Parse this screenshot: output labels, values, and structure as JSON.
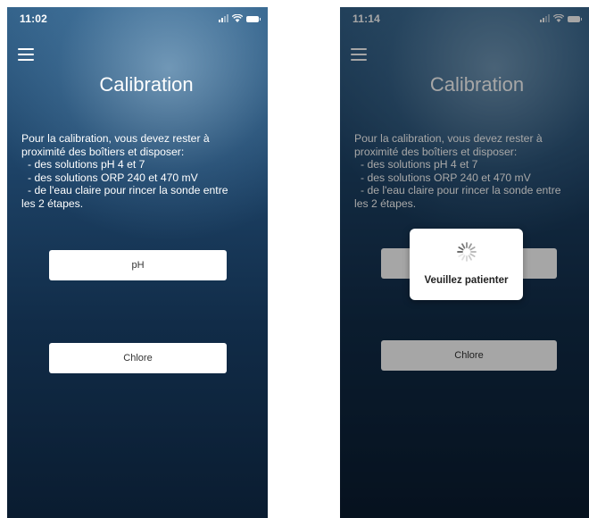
{
  "screens": [
    {
      "status": {
        "time": "11:02"
      },
      "title": "Calibration",
      "instructions": {
        "intro_line1": "Pour la calibration, vous devez rester à",
        "intro_line2": "proximité des boîtiers et disposer:",
        "bullet1": "- des solutions pH 4 et 7",
        "bullet2": "- des solutions ORP 240 et 470 mV",
        "bullet3_line1": "- de l'eau claire pour rincer la sonde entre",
        "bullet3_line2": "les 2 étapes."
      },
      "buttons": {
        "ph": "pH",
        "chlore": "Chlore"
      }
    },
    {
      "status": {
        "time": "11:14"
      },
      "title": "Calibration",
      "instructions": {
        "intro_line1": "Pour la calibration, vous devez rester à",
        "intro_line2": "proximité des boîtiers et disposer:",
        "bullet1": "- des solutions pH 4 et 7",
        "bullet2": "- des solutions ORP 240 et 470 mV",
        "bullet3_line1": "- de l'eau claire pour rincer la sonde entre",
        "bullet3_line2": "les 2 étapes."
      },
      "buttons": {
        "ph": "",
        "chlore": "Chlore"
      },
      "loading": {
        "text": "Veuillez patienter"
      }
    }
  ],
  "colors": {
    "background_top": "#33628a",
    "background_bottom": "#0a1c30",
    "button_background": "#ffffff",
    "button_text": "#333333"
  },
  "icons": [
    "menu-icon",
    "signal-icon",
    "wifi-icon",
    "battery-icon",
    "spinner-icon"
  ]
}
